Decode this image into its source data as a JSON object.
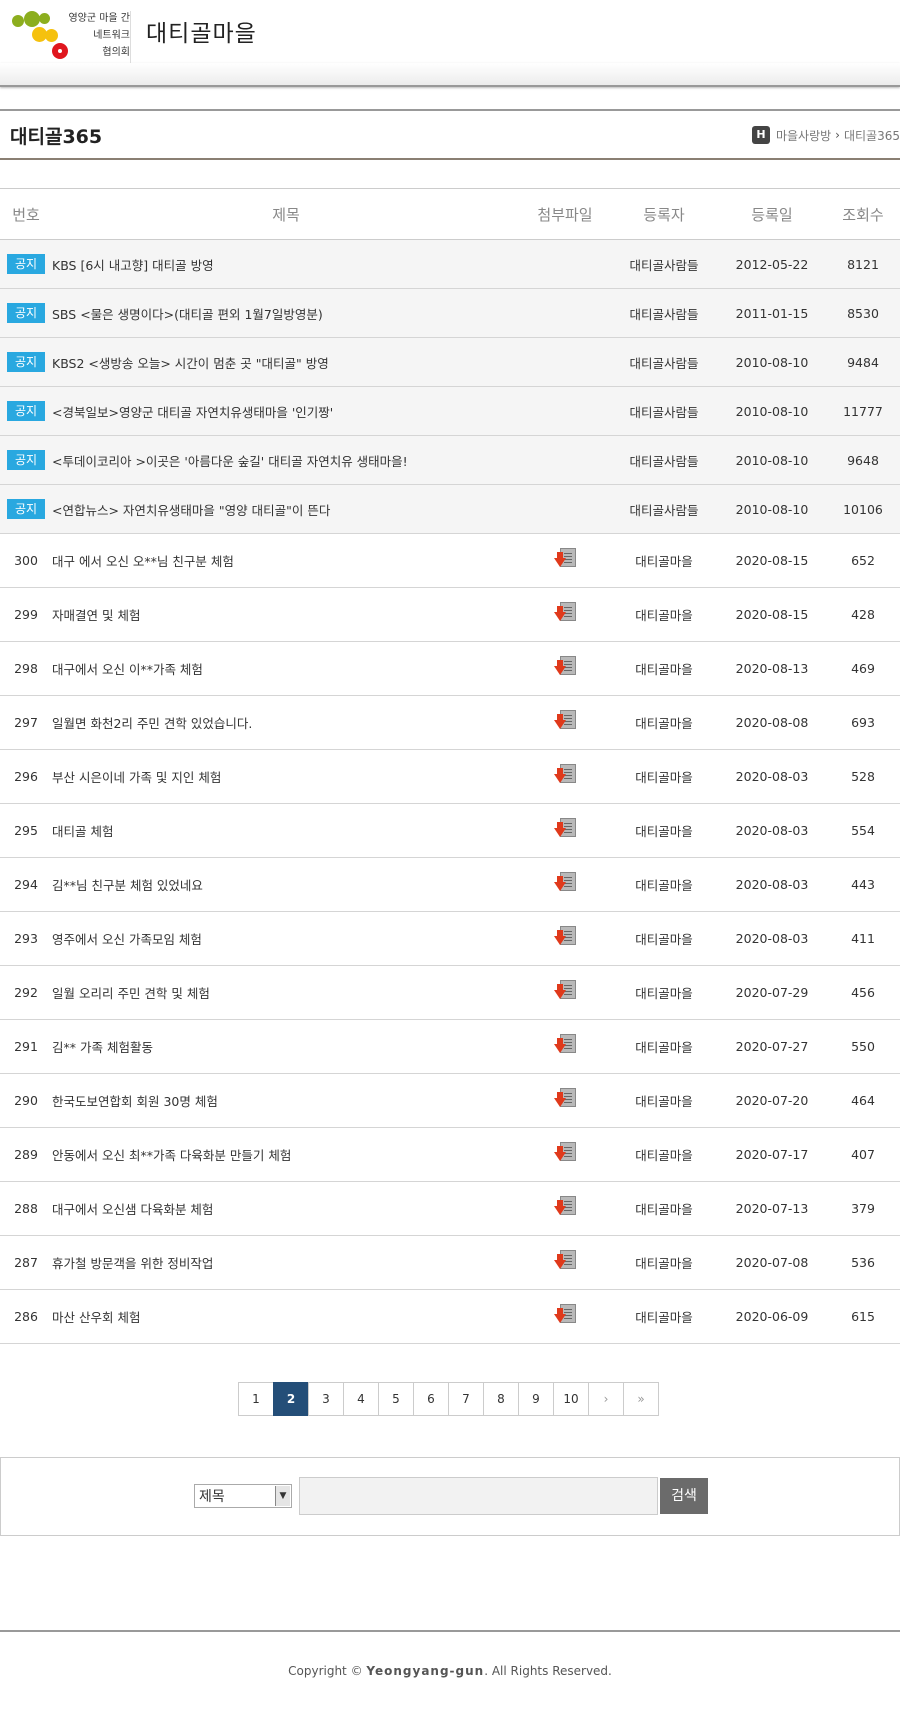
{
  "logo": {
    "line1": "영양군 마을 간",
    "line2": "네트워크",
    "line3": "협의회",
    "colors": [
      "#8cae1e",
      "#f5c10e",
      "#e0161e"
    ]
  },
  "site_name": "대티골마을",
  "page_title": "대티골365",
  "breadcrumb": {
    "home": "H",
    "parent": "마을사랑방",
    "current": "대티골365"
  },
  "table": {
    "headers": {
      "num": "번호",
      "subject": "제목",
      "file": "첨부파일",
      "author": "등록자",
      "date": "등록일",
      "views": "조회수"
    },
    "notice_label": "공지",
    "notices": [
      {
        "subject": "KBS [6시 내고향] 대티골 방영",
        "author": "대티골사람들",
        "date": "2012-05-22",
        "views": "8121"
      },
      {
        "subject": "SBS <물은 생명이다>(대티골 편외 1월7일방영분)",
        "author": "대티골사람들",
        "date": "2011-01-15",
        "views": "8530"
      },
      {
        "subject": "KBS2 <생방송 오늘> 시간이 멈춘 곳 \"대티골\" 방영",
        "author": "대티골사람들",
        "date": "2010-08-10",
        "views": "9484"
      },
      {
        "subject": "<경북일보>영양군 대티골 자연치유생태마을 '인기짱'",
        "author": "대티골사람들",
        "date": "2010-08-10",
        "views": "11777"
      },
      {
        "subject": "<투데이코리아 >이곳은 '아름다운 숲길' 대티골 자연치유 생태마을!",
        "author": "대티골사람들",
        "date": "2010-08-10",
        "views": "9648"
      },
      {
        "subject": "<연합뉴스> 자연치유생태마을 \"영양 대티골\"이 뜬다",
        "author": "대티골사람들",
        "date": "2010-08-10",
        "views": "10106"
      }
    ],
    "posts": [
      {
        "num": "300",
        "subject": "대구 에서 오신 오**님 친구분 체험",
        "author": "대티골마을",
        "date": "2020-08-15",
        "views": "652"
      },
      {
        "num": "299",
        "subject": "자매결연 및 체험",
        "author": "대티골마을",
        "date": "2020-08-15",
        "views": "428"
      },
      {
        "num": "298",
        "subject": "대구에서 오신 이**가족 체험",
        "author": "대티골마을",
        "date": "2020-08-13",
        "views": "469"
      },
      {
        "num": "297",
        "subject": "일월면 화천2리 주민 견학 있었습니다.",
        "author": "대티골마을",
        "date": "2020-08-08",
        "views": "693"
      },
      {
        "num": "296",
        "subject": "부산 시은이네 가족 및 지인 체험",
        "author": "대티골마을",
        "date": "2020-08-03",
        "views": "528"
      },
      {
        "num": "295",
        "subject": "대티골 체험",
        "author": "대티골마을",
        "date": "2020-08-03",
        "views": "554"
      },
      {
        "num": "294",
        "subject": "김**님 친구분 체험 있었네요",
        "author": "대티골마을",
        "date": "2020-08-03",
        "views": "443"
      },
      {
        "num": "293",
        "subject": "영주에서 오신 가족모임 체험",
        "author": "대티골마을",
        "date": "2020-08-03",
        "views": "411"
      },
      {
        "num": "292",
        "subject": "일월 오리리 주민 견학 및 체험",
        "author": "대티골마을",
        "date": "2020-07-29",
        "views": "456"
      },
      {
        "num": "291",
        "subject": "김** 가족 체험활동",
        "author": "대티골마을",
        "date": "2020-07-27",
        "views": "550"
      },
      {
        "num": "290",
        "subject": "한국도보연합회 회원 30명 체험",
        "author": "대티골마을",
        "date": "2020-07-20",
        "views": "464"
      },
      {
        "num": "289",
        "subject": "안동에서 오신 최**가족 다육화분 만들기 체험",
        "author": "대티골마을",
        "date": "2020-07-17",
        "views": "407"
      },
      {
        "num": "288",
        "subject": "대구에서 오신샘 다육화분 체험",
        "author": "대티골마을",
        "date": "2020-07-13",
        "views": "379"
      },
      {
        "num": "287",
        "subject": "휴가철 방문객을 위한 정비작업",
        "author": "대티골마을",
        "date": "2020-07-08",
        "views": "536"
      },
      {
        "num": "286",
        "subject": "마산 산우회 체험",
        "author": "대티골마을",
        "date": "2020-06-09",
        "views": "615"
      }
    ]
  },
  "pagination": {
    "pages": [
      "1",
      "2",
      "3",
      "4",
      "5",
      "6",
      "7",
      "8",
      "9",
      "10"
    ],
    "current": "2",
    "next": "›",
    "last": "»"
  },
  "search": {
    "field_selected": "제목",
    "button": "검색",
    "button_color": "#6b6b6b"
  },
  "footer": {
    "prefix": "Copyright © ",
    "brand": "Yeongyang-gun",
    "suffix": ". All Rights Reserved."
  },
  "colors": {
    "notice_badge": "#29a8e0",
    "active_page": "#244e78",
    "file_arrow": "#e0391b"
  }
}
